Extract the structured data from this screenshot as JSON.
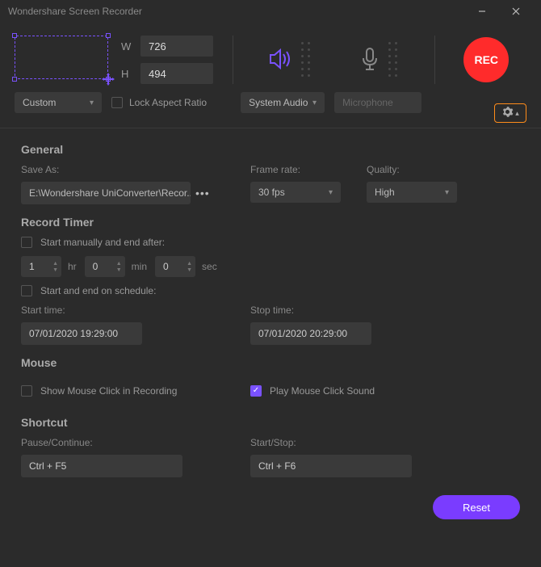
{
  "window": {
    "title": "Wondershare Screen Recorder"
  },
  "region": {
    "w_label": "W",
    "w_value": "726",
    "h_label": "H",
    "h_value": "494",
    "mode": "Custom",
    "lock_label": "Lock Aspect Ratio"
  },
  "audio": {
    "system_label": "System Audio",
    "mic_label": "Microphone"
  },
  "rec_label": "REC",
  "general": {
    "title": "General",
    "save_as_label": "Save As:",
    "save_as_value": "E:\\Wondershare UniConverter\\Recor...",
    "frame_rate_label": "Frame rate:",
    "frame_rate_value": "30 fps",
    "quality_label": "Quality:",
    "quality_value": "High"
  },
  "timer": {
    "title": "Record Timer",
    "manual_label": "Start manually and end after:",
    "hr": "1",
    "hr_unit": "hr",
    "min": "0",
    "min_unit": "min",
    "sec": "0",
    "sec_unit": "sec",
    "schedule_label": "Start and end on schedule:",
    "start_label": "Start time:",
    "start_value": "07/01/2020 19:29:00",
    "stop_label": "Stop time:",
    "stop_value": "07/01/2020 20:29:00"
  },
  "mouse": {
    "title": "Mouse",
    "show_click_label": "Show Mouse Click in Recording",
    "play_sound_label": "Play Mouse Click Sound",
    "play_sound_checked": true
  },
  "shortcut": {
    "title": "Shortcut",
    "pause_label": "Pause/Continue:",
    "pause_value": "Ctrl + F5",
    "startstop_label": "Start/Stop:",
    "startstop_value": "Ctrl + F6"
  },
  "reset_label": "Reset"
}
